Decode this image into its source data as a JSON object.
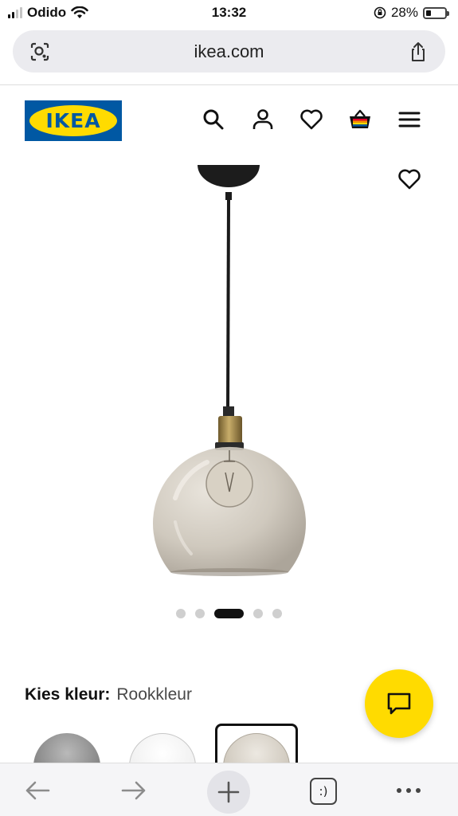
{
  "status_bar": {
    "carrier": "Odido",
    "time": "13:32",
    "battery_percent": "28%",
    "battery_level": 0.28
  },
  "browser": {
    "url": "ikea.com",
    "tabs_label": ":)"
  },
  "header": {
    "logo_text": "IKEA",
    "brand_blue": "#0058a3",
    "brand_yellow": "#ffdb00",
    "icons": [
      "search-icon",
      "account-icon",
      "heart-icon",
      "basket-icon",
      "menu-icon"
    ]
  },
  "product": {
    "carousel": {
      "total": 5,
      "active_index": 2
    }
  },
  "color_picker": {
    "label": "Kies kleur:",
    "selected": "Rookkleur",
    "swatches": [
      "grey",
      "clear",
      "smoke"
    ]
  },
  "chat": {
    "icon": "chat-icon"
  }
}
